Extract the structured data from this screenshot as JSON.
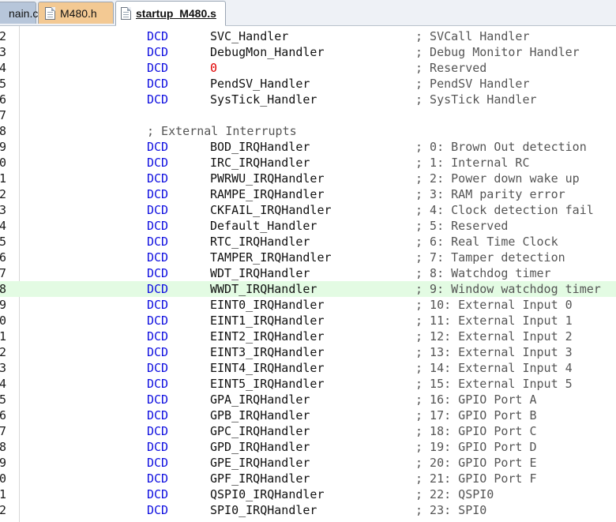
{
  "tabs": [
    {
      "label": "main.c",
      "shown": "nain.c",
      "active": false,
      "color": "#b7c6da"
    },
    {
      "label": "M480.h",
      "active": false,
      "color": "#f3c993"
    },
    {
      "label": "startup_M480.s",
      "active": true,
      "color": "#ffffff"
    }
  ],
  "colors": {
    "keyword": "#1010e0",
    "comment": "#555555",
    "number": "#e00000",
    "highlight_line": "#e3fbe3"
  },
  "code_lines": [
    {
      "num": "2",
      "kw": "DCD",
      "sym": "SVC_Handler",
      "cmt": "; SVCall Handler"
    },
    {
      "num": "3",
      "kw": "DCD",
      "sym": "DebugMon_Handler",
      "cmt": "; Debug Monitor Handler"
    },
    {
      "num": "4",
      "kw": "DCD",
      "sym": "0",
      "cmt": "; Reserved",
      "numeric": true
    },
    {
      "num": "5",
      "kw": "DCD",
      "sym": "PendSV_Handler",
      "cmt": "; PendSV Handler"
    },
    {
      "num": "6",
      "kw": "DCD",
      "sym": "SysTick_Handler",
      "cmt": "; SysTick Handler"
    },
    {
      "num": "7",
      "kw": "",
      "sym": "",
      "cmt": ""
    },
    {
      "num": "8",
      "section": "; External Interrupts"
    },
    {
      "num": "9",
      "kw": "DCD",
      "sym": "BOD_IRQHandler",
      "cmt": "; 0: Brown Out detection"
    },
    {
      "num": "0",
      "kw": "DCD",
      "sym": "IRC_IRQHandler",
      "cmt": "; 1: Internal RC"
    },
    {
      "num": "1",
      "kw": "DCD",
      "sym": "PWRWU_IRQHandler",
      "cmt": "; 2: Power down wake up"
    },
    {
      "num": "2",
      "kw": "DCD",
      "sym": "RAMPE_IRQHandler",
      "cmt": "; 3: RAM parity error"
    },
    {
      "num": "3",
      "kw": "DCD",
      "sym": "CKFAIL_IRQHandler",
      "cmt": "; 4: Clock detection fail"
    },
    {
      "num": "4",
      "kw": "DCD",
      "sym": "Default_Handler",
      "cmt": "; 5: Reserved"
    },
    {
      "num": "5",
      "kw": "DCD",
      "sym": "RTC_IRQHandler",
      "cmt": "; 6: Real Time Clock"
    },
    {
      "num": "6",
      "kw": "DCD",
      "sym": "TAMPER_IRQHandler",
      "cmt": "; 7: Tamper detection"
    },
    {
      "num": "7",
      "kw": "DCD",
      "sym": "WDT_IRQHandler",
      "cmt": "; 8: Watchdog timer"
    },
    {
      "num": "8",
      "kw": "DCD",
      "sym": "WWDT_IRQHandler",
      "cmt": "; 9: Window watchdog timer",
      "highlight": true
    },
    {
      "num": "9",
      "kw": "DCD",
      "sym": "EINT0_IRQHandler",
      "cmt": "; 10: External Input 0"
    },
    {
      "num": "0",
      "kw": "DCD",
      "sym": "EINT1_IRQHandler",
      "cmt": "; 11: External Input 1"
    },
    {
      "num": "1",
      "kw": "DCD",
      "sym": "EINT2_IRQHandler",
      "cmt": "; 12: External Input 2"
    },
    {
      "num": "2",
      "kw": "DCD",
      "sym": "EINT3_IRQHandler",
      "cmt": "; 13: External Input 3"
    },
    {
      "num": "3",
      "kw": "DCD",
      "sym": "EINT4_IRQHandler",
      "cmt": "; 14: External Input 4"
    },
    {
      "num": "4",
      "kw": "DCD",
      "sym": "EINT5_IRQHandler",
      "cmt": "; 15: External Input 5"
    },
    {
      "num": "5",
      "kw": "DCD",
      "sym": "GPA_IRQHandler",
      "cmt": "; 16: GPIO Port A"
    },
    {
      "num": "6",
      "kw": "DCD",
      "sym": "GPB_IRQHandler",
      "cmt": "; 17: GPIO Port B"
    },
    {
      "num": "7",
      "kw": "DCD",
      "sym": "GPC_IRQHandler",
      "cmt": "; 18: GPIO Port C"
    },
    {
      "num": "8",
      "kw": "DCD",
      "sym": "GPD_IRQHandler",
      "cmt": "; 19: GPIO Port D"
    },
    {
      "num": "9",
      "kw": "DCD",
      "sym": "GPE_IRQHandler",
      "cmt": "; 20: GPIO Port E"
    },
    {
      "num": "0",
      "kw": "DCD",
      "sym": "GPF_IRQHandler",
      "cmt": "; 21: GPIO Port F"
    },
    {
      "num": "1",
      "kw": "DCD",
      "sym": "QSPI0_IRQHandler",
      "cmt": "; 22: QSPI0"
    },
    {
      "num": "2",
      "kw": "DCD",
      "sym": "SPI0_IRQHandler",
      "cmt": "; 23: SPI0"
    }
  ]
}
